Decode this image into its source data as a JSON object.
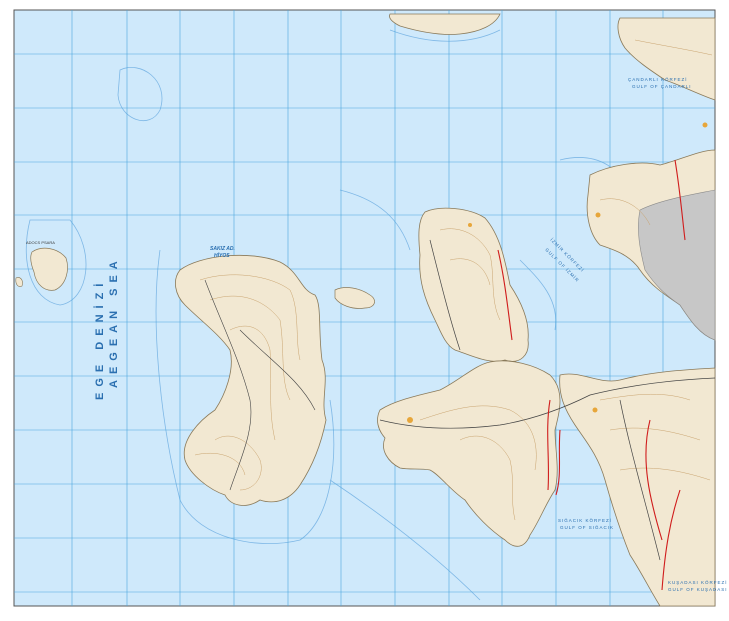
{
  "map": {
    "colors": {
      "sea": "#cfe9fb",
      "deep_line": "#7fb8e6",
      "grid": "#4aa6de",
      "land": "#f2e8d2",
      "land_gray": "#c7c7c7",
      "contour": "#c9a36e",
      "road": "#444444",
      "fault": "#d01c1c"
    },
    "labels": {
      "ege_denizi": "EGE DENİZİ",
      "aegean_sea": "AEGEAN SEA",
      "sakiz_adasi": "SAKIZ AD.",
      "hiyos": "HİYOS",
      "candarli_tr": "ÇANDARLI KÖRFEZİ",
      "candarli_en": "GULF OF ÇANDARLI",
      "izmir_tr": "İZMİR KÖRFEZİ",
      "izmir_en": "GULF OF İZMİR",
      "sigacik_tr": "SIĞACIK KÖRFEZİ",
      "sigacik_en": "GULF OF SIĞACIK",
      "kusadasi_tr": "KUŞADASI KÖRFEZİ",
      "kusadasi_en": "GULF OF KUŞADASI",
      "psara": "ADOCS PSARA"
    }
  }
}
